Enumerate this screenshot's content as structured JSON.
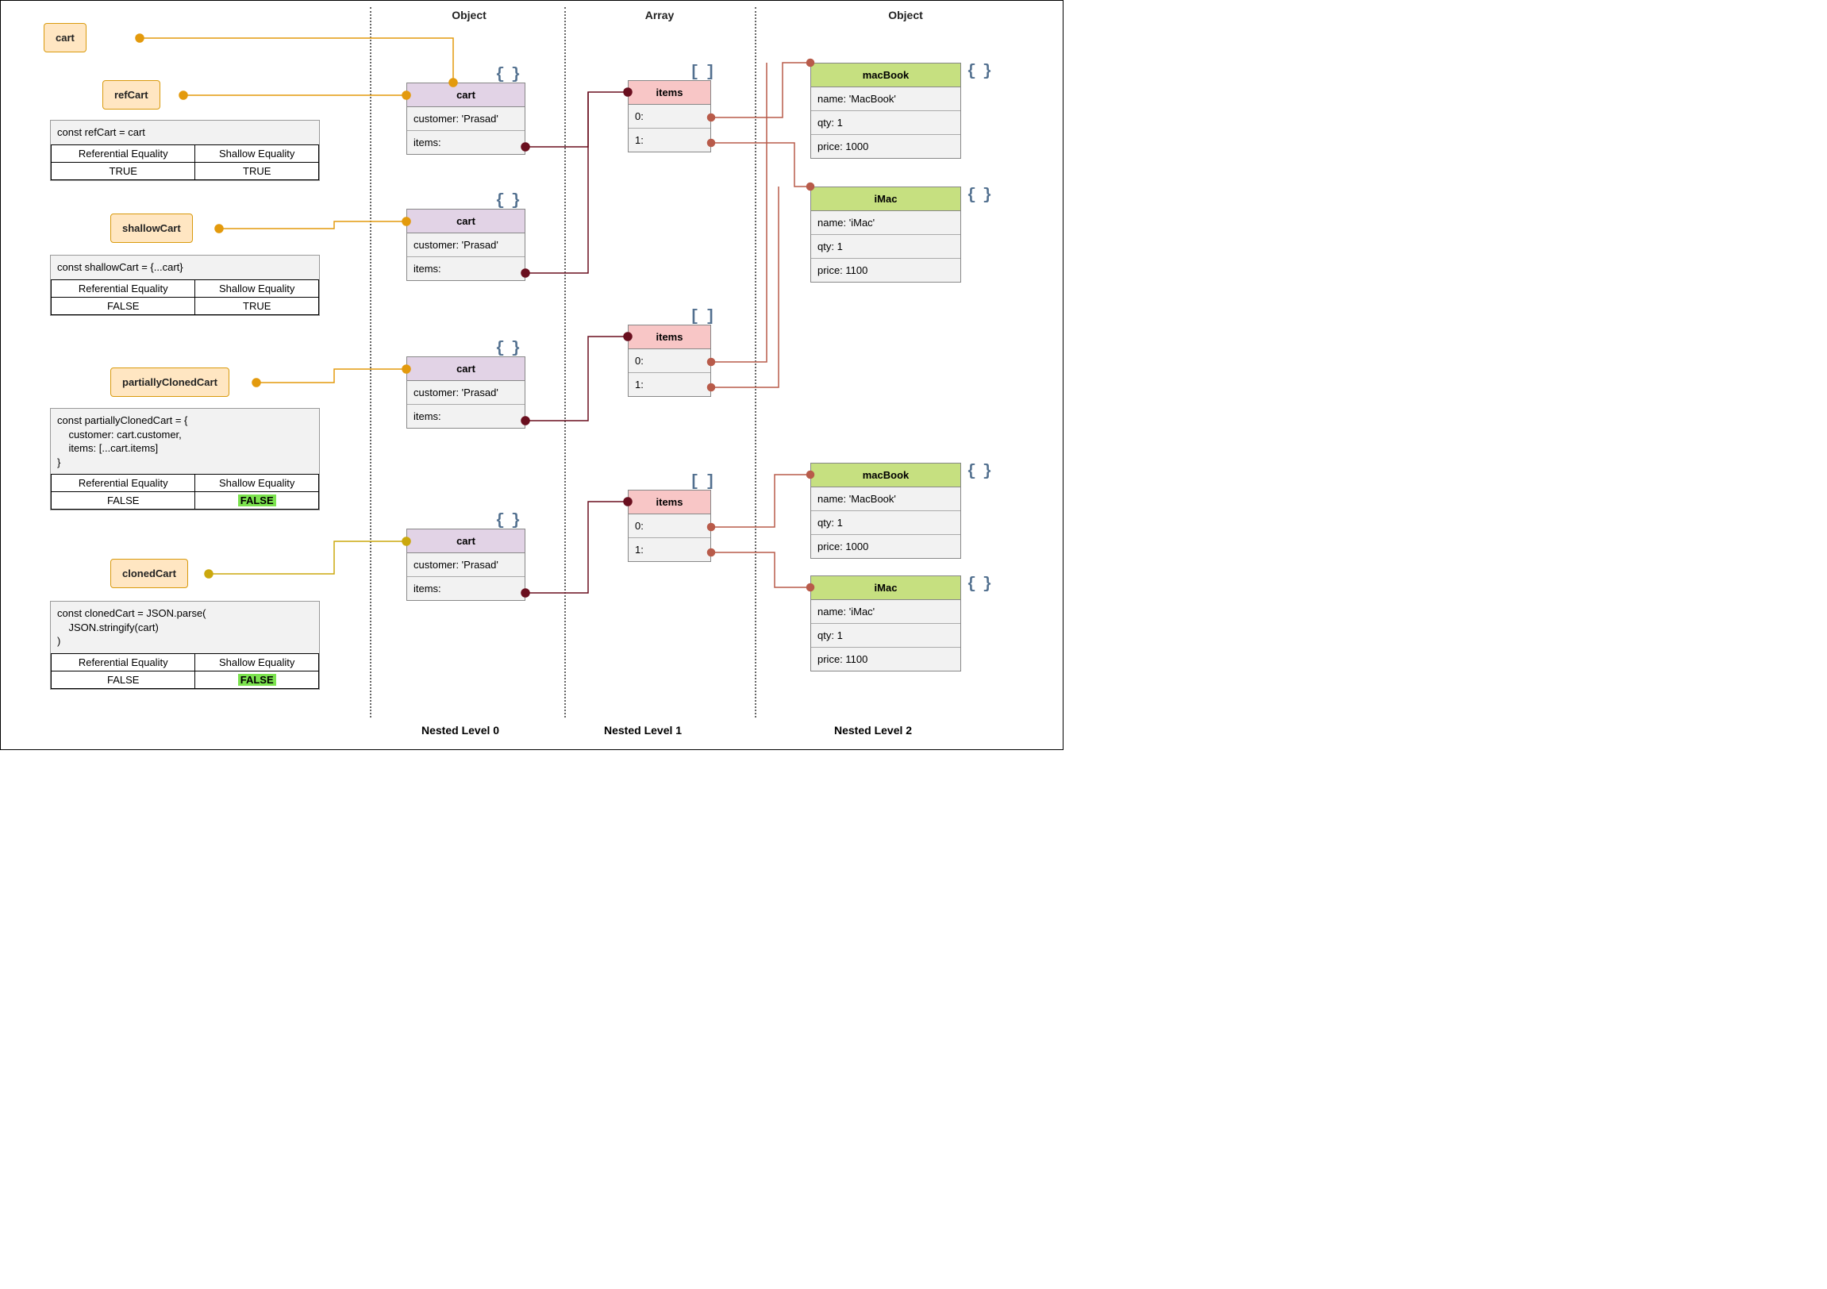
{
  "columnHeaders": {
    "object1": "Object",
    "array": "Array",
    "object2": "Object"
  },
  "bottomLabels": {
    "l0": "Nested Level 0",
    "l1": "Nested Level 1",
    "l2": "Nested Level 2"
  },
  "sources": {
    "cart": "cart",
    "refCart": "refCart",
    "shallowCart": "shallowCart",
    "partiallyClonedCart": "partiallyClonedCart",
    "clonedCart": "clonedCart"
  },
  "panels": {
    "refCart": {
      "code": "const refCart = cart",
      "headers": {
        "ref": "Referential Equality",
        "shal": "Shallow Equality"
      },
      "values": {
        "ref": "TRUE",
        "shal": "TRUE"
      },
      "highlightShallow": false
    },
    "shallowCart": {
      "code": "const shallowCart = {...cart}",
      "headers": {
        "ref": "Referential Equality",
        "shal": "Shallow Equality"
      },
      "values": {
        "ref": "FALSE",
        "shal": "TRUE"
      },
      "highlightShallow": false
    },
    "partiallyClonedCart": {
      "code": "const partiallyClonedCart = {\n    customer: cart.customer,\n    items: [...cart.items]\n}",
      "headers": {
        "ref": "Referential Equality",
        "shal": "Shallow Equality"
      },
      "values": {
        "ref": "FALSE",
        "shal": "FALSE"
      },
      "highlightShallow": true
    },
    "clonedCart": {
      "code": "const clonedCart = JSON.parse(\n    JSON.stringify(cart)\n)",
      "headers": {
        "ref": "Referential Equality",
        "shal": "Shallow Equality"
      },
      "values": {
        "ref": "FALSE",
        "shal": "FALSE"
      },
      "highlightShallow": true
    }
  },
  "cartObject": {
    "title": "cart",
    "rows": {
      "customer": "customer: 'Prasad'",
      "items": "items:"
    }
  },
  "itemsArray": {
    "title": "items",
    "rows": {
      "i0": "0:",
      "i1": "1:"
    }
  },
  "macBook": {
    "title": "macBook",
    "rows": {
      "name": "name: 'MacBook'",
      "qty": "qty: 1",
      "price": "price: 1000"
    }
  },
  "iMac": {
    "title": "iMac",
    "rows": {
      "name": "name: 'iMac'",
      "qty": "qty: 1",
      "price": "price: 1100"
    }
  },
  "icons": {
    "braces": "{ }",
    "brackets": "[ ]"
  }
}
